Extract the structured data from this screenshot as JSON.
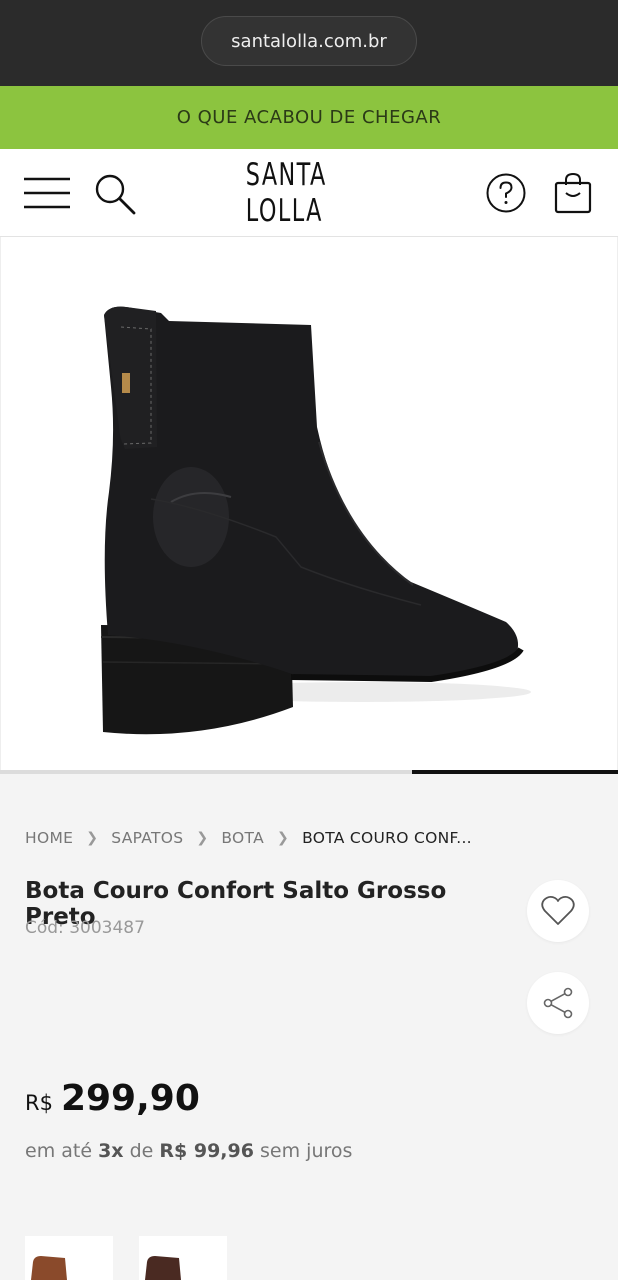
{
  "browser": {
    "url": "santalolla.com.br"
  },
  "promo": {
    "text": "O QUE ACABOU DE CHEGAR"
  },
  "header": {
    "logo_text": "SANTA LOLLA",
    "menu_icon": "hamburger-icon",
    "search_icon": "search-icon",
    "help_icon": "question-circle-icon",
    "bag_icon": "shopping-bag-icon"
  },
  "breadcrumb": {
    "items": [
      "HOME",
      "SAPATOS",
      "BOTA",
      "BOTA COURO CONF..."
    ],
    "separator_icon": "chevron-right-icon"
  },
  "product": {
    "title": "Bota Couro Confort Salto Grosso Preto",
    "code": "Cód: 3003487",
    "price_currency": "R$",
    "price_value": "299,90",
    "installments": {
      "prefix": "em até",
      "count": "3x",
      "middle": "de",
      "amount": "R$ 99,96",
      "suffix": "sem juros"
    },
    "favorite_icon": "heart-icon",
    "share_icon": "share-icon"
  },
  "carousel": {
    "active_index": 2,
    "total": 3
  },
  "colors": {
    "promo_bg": "#8cc43f",
    "browser_bg": "#2b2b2b",
    "thumb_brown": "#8a4a2b",
    "thumb_darkbrown": "#4a2a22"
  }
}
